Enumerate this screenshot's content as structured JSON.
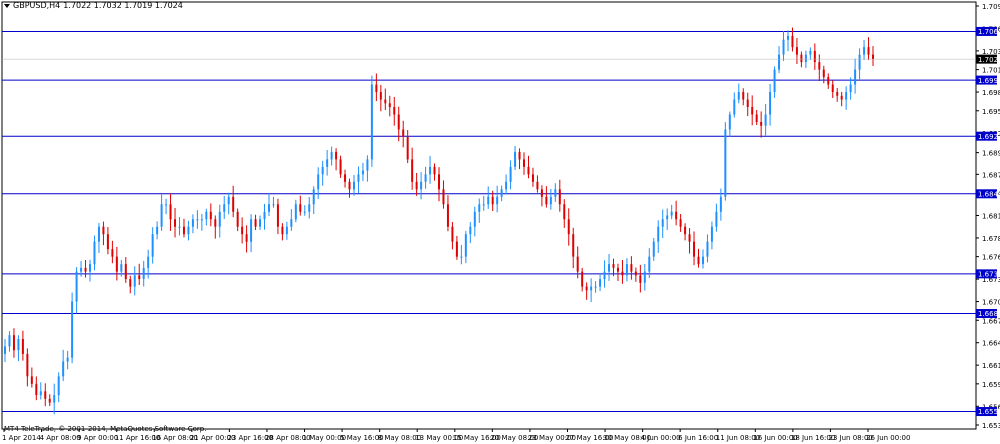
{
  "symbol": {
    "name": "GBPUSD,H4",
    "ohlc": "1.7022 1.7032 1.7019 1.7024"
  },
  "copyright": "MT4 TeleTrade, © 2001-2014, MetaQuotes Software Corp.",
  "colors": {
    "background": "#ffffff",
    "bull": "#1e90ff",
    "bear": "#e00000",
    "level_line": "#0000cc",
    "level_tag_bg": "#0000cc",
    "current_tag_bg": "#000000",
    "axis": "#000000"
  },
  "chart_data": {
    "type": "candlestick",
    "symbol": "GBPUSD",
    "timeframe": "H4",
    "ylim": [
      1.6535,
      1.7095
    ],
    "y_ticks": [
      "1.7095",
      "1.7065",
      "1.7035",
      "1.7010",
      "1.6980",
      "1.6955",
      "1.6925",
      "1.6899",
      "1.6870",
      "1.6845",
      "1.6815",
      "1.6785",
      "1.6760",
      "1.6730",
      "1.6700",
      "1.6675",
      "1.6645",
      "1.6615",
      "1.6590",
      "1.6560",
      "1.6535"
    ],
    "x_ticks": [
      "1 Apr 2014",
      "4 Apr 08:00",
      "9 Apr 00:00",
      "11 Apr 16:00",
      "16 Apr 08:00",
      "21 Apr 00:00",
      "23 Apr 16:00",
      "28 Apr 08:00",
      "1 May 00:00",
      "5 May 16:00",
      "8 May 08:00",
      "13 May 00:00",
      "15 May 16:00",
      "20 May 08:00",
      "23 May 00:00",
      "27 May 16:00",
      "30 May 08:00",
      "4 Jun 00:00",
      "6 Jun 16:00",
      "11 Jun 08:00",
      "16 Jun 00:00",
      "18 Jun 16:00",
      "23 Jun 08:00",
      "26 Jun 00:00"
    ],
    "levels": [
      "1.7061",
      "1.6996",
      "1.6921",
      "1.6844",
      "1.6737",
      "1.6684",
      "1.6553"
    ],
    "current_price": "1.7024",
    "close_path": [
      [
        1.664,
        1.6655,
        1.6635,
        1.665,
        1.663,
        1.66,
        1.659,
        1.6575,
        1.658,
        1.657,
        1.6565,
        1.6575,
        1.66,
        1.662,
        1.6625,
        1.67,
        1.674,
        1.6745,
        1.674,
        1.675,
        1.678,
        1.68,
        1.679,
        1.677,
        1.676,
        1.674,
        1.675,
        1.673,
        1.672,
        1.6735,
        1.673,
        1.6745,
        1.676,
        1.679
      ],
      [
        1.68,
        1.683,
        1.683,
        1.681,
        1.68,
        1.68,
        1.679,
        1.68,
        1.681,
        1.681,
        1.681,
        1.682,
        1.681,
        1.68,
        1.682,
        1.683,
        1.684,
        1.682,
        1.68,
        1.679,
        1.678,
        1.681,
        1.68,
        1.681,
        1.682,
        1.683,
        1.683,
        1.68,
        1.679,
        1.68,
        1.681,
        1.683,
        1.682,
        1.682
      ],
      [
        1.683,
        1.685,
        1.687,
        1.688,
        1.689,
        1.69,
        1.689,
        1.687,
        1.686,
        1.685,
        1.686,
        1.687,
        1.6875,
        1.689,
        1.699,
        1.698,
        1.697,
        1.6965,
        1.696,
        1.695,
        1.693,
        1.692,
        1.689,
        1.686,
        1.685,
        1.686,
        1.687,
        1.688,
        1.687,
        1.685,
        1.683,
        1.68,
        1.678,
        1.676
      ],
      [
        1.676,
        1.679,
        1.68,
        1.682,
        1.683,
        1.683,
        1.684,
        1.683,
        1.684,
        1.685,
        1.686,
        1.688,
        1.69,
        1.689,
        1.688,
        1.687,
        1.686,
        1.685,
        1.684,
        1.683,
        1.684,
        1.685,
        1.683,
        1.681,
        1.679,
        1.676,
        1.674,
        1.672,
        1.6715,
        1.672,
        1.672,
        1.673,
        1.674,
        1.675
      ],
      [
        1.6745,
        1.674,
        1.6735,
        1.675,
        1.674,
        1.6735,
        1.6725,
        1.674,
        1.676,
        1.678,
        1.68,
        1.681,
        1.6815,
        1.682,
        1.681,
        1.68,
        1.679,
        1.678,
        1.676,
        1.675,
        1.676,
        1.678,
        1.68,
        1.682,
        1.684,
        1.693,
        1.695,
        1.697,
        1.698,
        1.697,
        1.696,
        1.695,
        1.694,
        1.6935
      ],
      [
        1.695,
        1.698,
        1.701,
        1.703,
        1.705,
        1.7055,
        1.704,
        1.703,
        1.702,
        1.703,
        1.7035,
        1.702,
        1.701,
        1.7,
        1.699,
        1.698,
        1.6975,
        1.697,
        1.698,
        1.699,
        1.701,
        1.703,
        1.704,
        1.703,
        1.7024
      ]
    ]
  }
}
